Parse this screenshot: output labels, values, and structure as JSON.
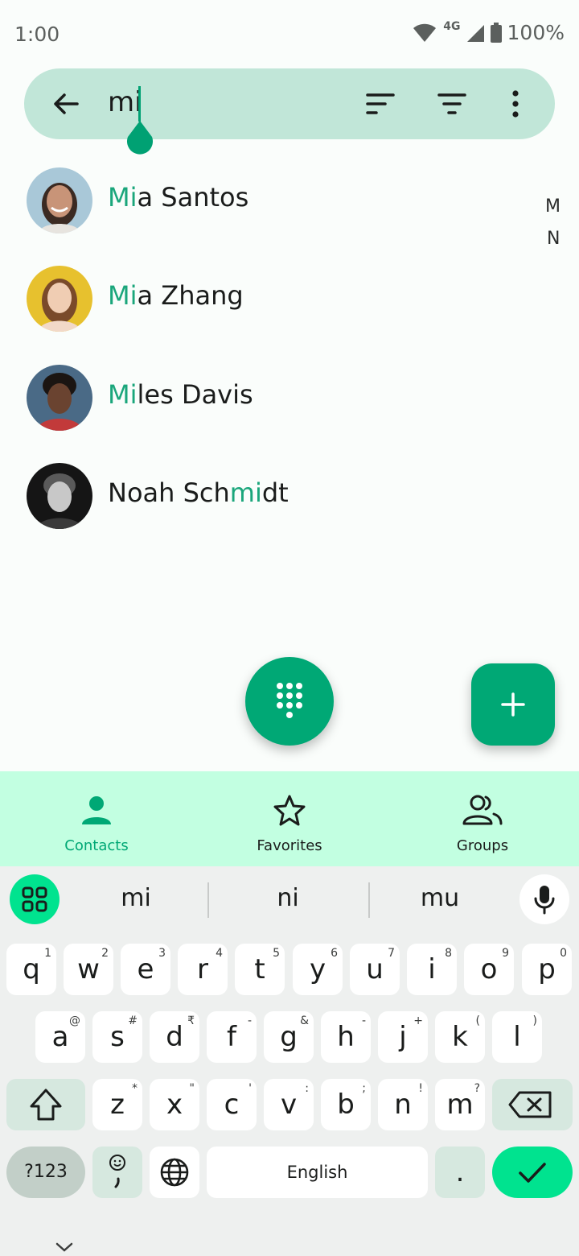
{
  "status_bar": {
    "time": "1:00",
    "network": "4G",
    "battery": "100%"
  },
  "search": {
    "query": "mi"
  },
  "contacts": [
    {
      "highlight": "Mi",
      "prefix": "",
      "rest": "a Santos"
    },
    {
      "highlight": "Mi",
      "prefix": "",
      "rest": "a Zhang"
    },
    {
      "highlight": "Mi",
      "prefix": "",
      "rest": "les Davis"
    },
    {
      "highlight": "mi",
      "prefix": "Noah Sch",
      "rest": "dt"
    }
  ],
  "index_letters": [
    "M",
    "N"
  ],
  "bottom_nav": {
    "contacts": "Contacts",
    "favorites": "Favorites",
    "groups": "Groups",
    "active": "Contacts"
  },
  "keyboard": {
    "suggestions": [
      "mi",
      "ni",
      "mu"
    ],
    "row1": [
      [
        "q",
        "1"
      ],
      [
        "w",
        "2"
      ],
      [
        "e",
        "3"
      ],
      [
        "r",
        "4"
      ],
      [
        "t",
        "5"
      ],
      [
        "y",
        "6"
      ],
      [
        "u",
        "7"
      ],
      [
        "i",
        "8"
      ],
      [
        "o",
        "9"
      ],
      [
        "p",
        "0"
      ]
    ],
    "row2": [
      [
        "a",
        "@"
      ],
      [
        "s",
        "#"
      ],
      [
        "d",
        "₹"
      ],
      [
        "f",
        "-"
      ],
      [
        "g",
        "&"
      ],
      [
        "h",
        "-"
      ],
      [
        "j",
        "+"
      ],
      [
        "k",
        "("
      ],
      [
        "l",
        ")"
      ]
    ],
    "row3": [
      [
        "z",
        "*"
      ],
      [
        "x",
        "\""
      ],
      [
        "c",
        "'"
      ],
      [
        "v",
        ":"
      ],
      [
        "b",
        ";"
      ],
      [
        "n",
        "!"
      ],
      [
        "m",
        "?"
      ]
    ],
    "symbols_label": "?123",
    "space_label": "English",
    "period_label": "."
  },
  "colors": {
    "accent": "#00a875",
    "highlight_text": "#1aa67b",
    "searchbar": "#c1e6d8",
    "nav_bg": "#c2ffe1",
    "enter_key": "#00e38f"
  }
}
